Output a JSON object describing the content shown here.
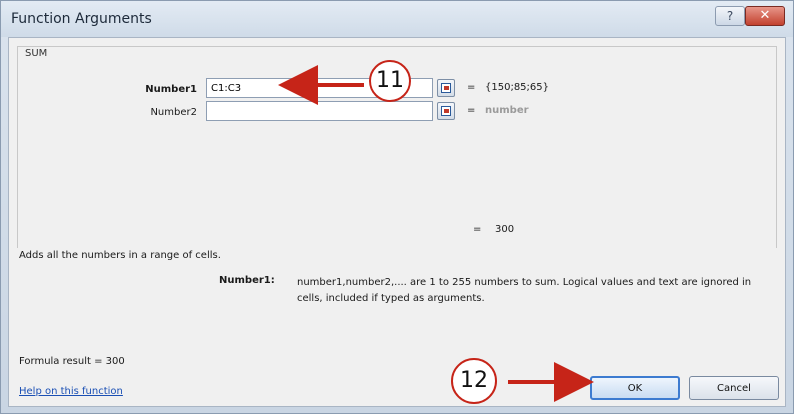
{
  "window": {
    "title": "Function Arguments",
    "help_glyph": "?",
    "close_glyph": "✕"
  },
  "group": {
    "title": "SUM",
    "args": [
      {
        "label": "Number1",
        "value": "C1:C3",
        "result": "{150;85;65}"
      },
      {
        "label": "Number2",
        "value": "",
        "result": "number"
      }
    ],
    "equals_sign": "=",
    "total": "300"
  },
  "description": "Adds all the numbers in a range of cells.",
  "arg_help": {
    "name": "Number1:",
    "text": "number1,number2,.... are 1 to 255 numbers to sum. Logical values and text are ignored in cells, included if typed as arguments."
  },
  "formula_result": {
    "label": "Formula result =",
    "value": "300"
  },
  "help_link": "Help on this function",
  "buttons": {
    "ok": "OK",
    "cancel": "Cancel"
  },
  "annotations": [
    {
      "text": "11",
      "color": "#c62418"
    },
    {
      "text": "12",
      "color": "#c62418"
    }
  ]
}
